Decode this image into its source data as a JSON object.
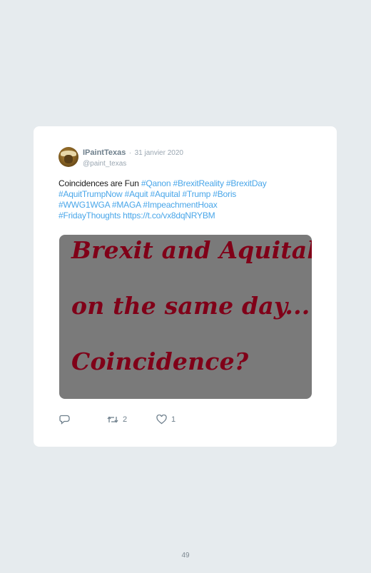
{
  "tweet": {
    "display_name": "IPaintTexas",
    "separator": "·",
    "date": "31 janvier 2020",
    "handle": "@paint_texas",
    "text_plain": "Coincidences are Fun ",
    "text_tags_1": "#Qanon #BrexitReality #BrexitDay",
    "text_tags_2": "#AquitTrumpNow #Aquit #Aquital #Trump #Boris",
    "text_tags_3": "#WWG1WGA #MAGA #ImpeachmentHoax",
    "text_tags_4": "#FridayThoughts https://t.co/vx8dqNRYBM"
  },
  "media": {
    "line1": "Brexit and Aquital",
    "line2": "on the same day...",
    "line3": "Coincidence?"
  },
  "actions": {
    "reply_icon": "reply-icon",
    "retweet_icon": "retweet-icon",
    "like_icon": "heart-icon",
    "retweet_count": "2",
    "like_count": "1"
  },
  "page": {
    "number": "49"
  },
  "colors": {
    "background": "#e6ebee",
    "hashtag": "#49a6e9",
    "media_bg": "#7a7a7a",
    "media_text": "#800018"
  }
}
